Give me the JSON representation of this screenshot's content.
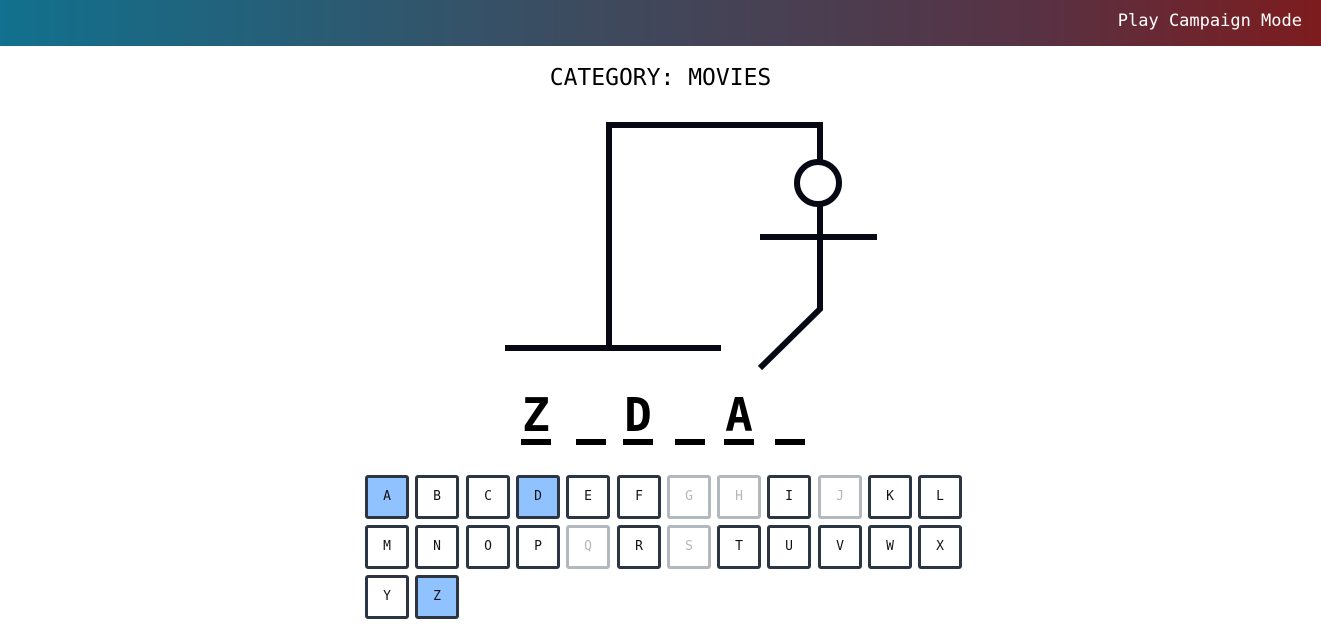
{
  "header": {
    "campaign_link": "Play Campaign Mode",
    "gradient_colors": [
      "#11718e",
      "#3e4a5e",
      "#573244",
      "#7d1c1e"
    ]
  },
  "game": {
    "category_text": "CATEGORY: MOVIES",
    "word_slots": [
      "Z",
      "",
      "D",
      "",
      "A",
      ""
    ],
    "hangman_parts_visible": [
      "head",
      "body",
      "arms",
      "left-leg"
    ]
  },
  "keyboard": {
    "keys": [
      {
        "letter": "A",
        "state": "selected"
      },
      {
        "letter": "B",
        "state": "normal"
      },
      {
        "letter": "C",
        "state": "normal"
      },
      {
        "letter": "D",
        "state": "selected"
      },
      {
        "letter": "E",
        "state": "normal"
      },
      {
        "letter": "F",
        "state": "normal"
      },
      {
        "letter": "G",
        "state": "disabled"
      },
      {
        "letter": "H",
        "state": "disabled"
      },
      {
        "letter": "I",
        "state": "normal"
      },
      {
        "letter": "J",
        "state": "disabled"
      },
      {
        "letter": "K",
        "state": "normal"
      },
      {
        "letter": "L",
        "state": "normal"
      },
      {
        "letter": "M",
        "state": "normal"
      },
      {
        "letter": "N",
        "state": "normal"
      },
      {
        "letter": "O",
        "state": "normal"
      },
      {
        "letter": "P",
        "state": "normal"
      },
      {
        "letter": "Q",
        "state": "disabled"
      },
      {
        "letter": "R",
        "state": "normal"
      },
      {
        "letter": "S",
        "state": "disabled"
      },
      {
        "letter": "T",
        "state": "normal"
      },
      {
        "letter": "U",
        "state": "normal"
      },
      {
        "letter": "V",
        "state": "normal"
      },
      {
        "letter": "W",
        "state": "normal"
      },
      {
        "letter": "X",
        "state": "normal"
      },
      {
        "letter": "Y",
        "state": "normal"
      },
      {
        "letter": "Z",
        "state": "selected"
      }
    ],
    "selected_color": "#90c2ff",
    "border_color": "#2b3642",
    "disabled_color": "#b3b8be"
  }
}
